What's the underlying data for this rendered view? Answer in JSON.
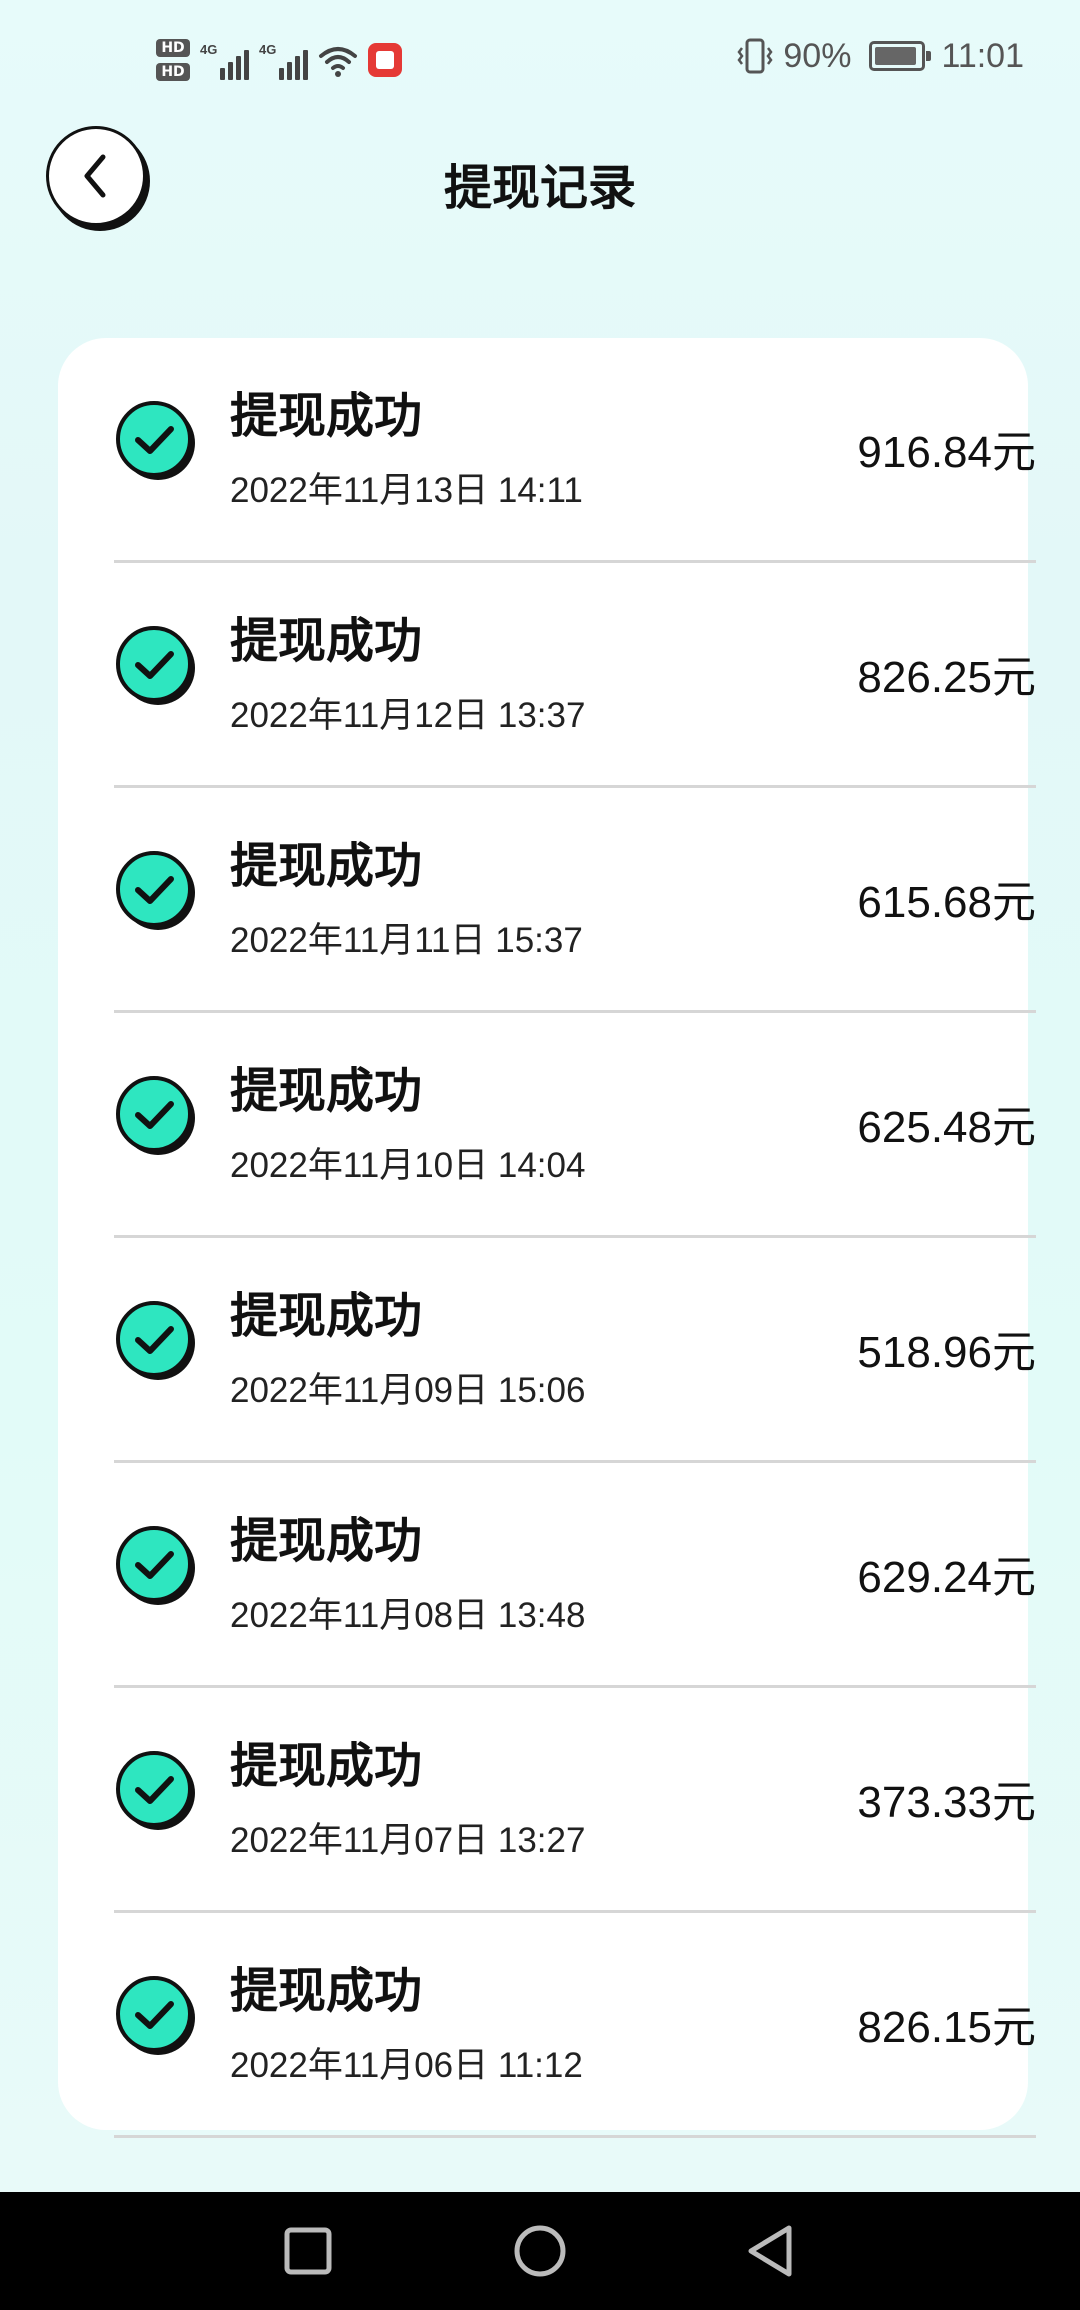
{
  "status_bar": {
    "hd1": "HD",
    "hd2": "HD",
    "net1": "4G",
    "net2": "4G",
    "battery_percent": "90%",
    "time": "11:01",
    "battery_level": 0.9
  },
  "header": {
    "title": "提现记录",
    "back_icon": "chevron-left-icon"
  },
  "records": [
    {
      "status": "提现成功",
      "datetime": "2022年11月13日 14:11",
      "amount": "916.84元"
    },
    {
      "status": "提现成功",
      "datetime": "2022年11月12日 13:37",
      "amount": "826.25元"
    },
    {
      "status": "提现成功",
      "datetime": "2022年11月11日 15:37",
      "amount": "615.68元"
    },
    {
      "status": "提现成功",
      "datetime": "2022年11月10日 14:04",
      "amount": "625.48元"
    },
    {
      "status": "提现成功",
      "datetime": "2022年11月09日 15:06",
      "amount": "518.96元"
    },
    {
      "status": "提现成功",
      "datetime": "2022年11月08日 13:48",
      "amount": "629.24元"
    },
    {
      "status": "提现成功",
      "datetime": "2022年11月07日 13:27",
      "amount": "373.33元"
    },
    {
      "status": "提现成功",
      "datetime": "2022年11月06日 11:12",
      "amount": "826.15元"
    }
  ],
  "colors": {
    "accent": "#2ee6c0",
    "background": "#e4f9f8",
    "card": "#ffffff",
    "divider": "#d6d6d6",
    "nav_bar": "#000000"
  },
  "nav_bar": {
    "icons": [
      "recent-apps-icon",
      "home-icon",
      "back-triangle-icon"
    ]
  }
}
